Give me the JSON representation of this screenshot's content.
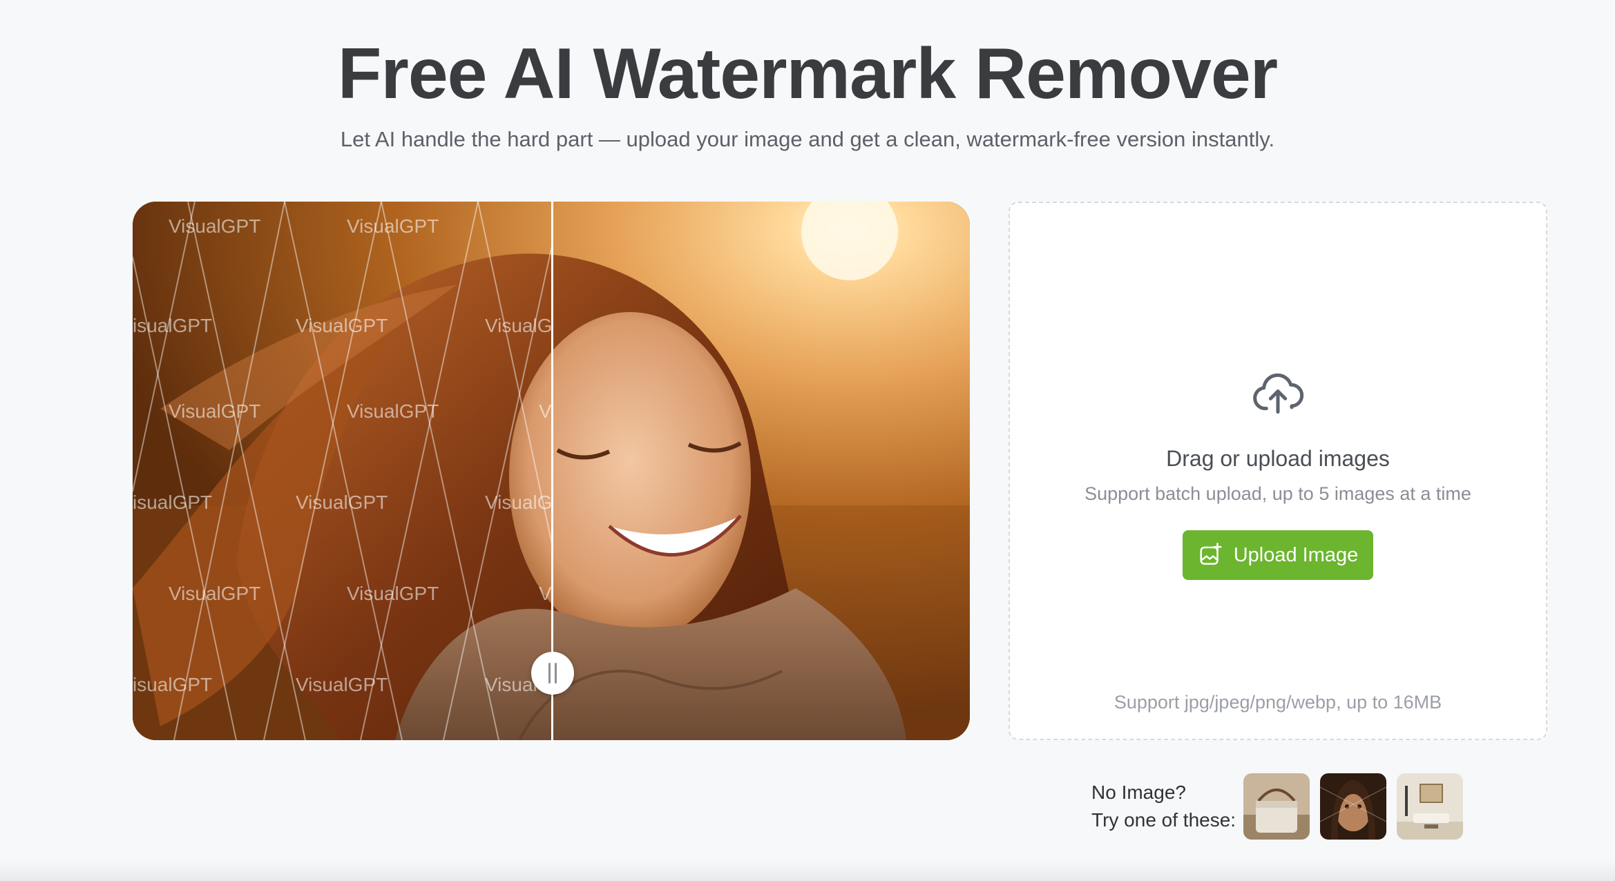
{
  "header": {
    "title": "Free AI Watermark Remover",
    "subtitle": "Let AI handle the hard part — upload your image and get a clean, watermark-free version instantly."
  },
  "compare": {
    "watermark_text": "VisualGPT",
    "watermark_visible": [
      "VisualGPT",
      "VisualGPT",
      "isualGPT",
      "VisualGPT",
      "VisualG",
      "VisualGPT",
      "VisualGPT",
      "V",
      "isualGPT",
      "VisualGPT",
      "VisualG",
      "VisualGPT",
      "VisualGPT",
      "V",
      "isualGPT",
      "VisualGPT",
      "VisualG"
    ],
    "slider_position_fraction": 0.5
  },
  "upload": {
    "icon": "cloud-upload-icon",
    "title": "Drag or upload images",
    "subtitle": "Support batch upload, up to 5 images at a time",
    "button_label": "Upload Image",
    "button_icon": "image-add-icon",
    "formats": "Support jpg/jpeg/png/webp, up to 16MB",
    "accent": "#6cb52f"
  },
  "samples": {
    "line1": "No Image?",
    "line2": "Try one of these:",
    "items": [
      "handbag",
      "portrait",
      "living-room"
    ]
  }
}
